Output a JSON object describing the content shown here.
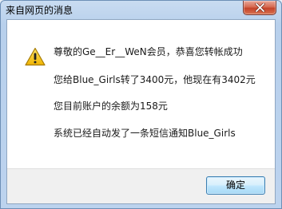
{
  "window": {
    "title": "来自网页的消息"
  },
  "dialog": {
    "icon": "warning-icon",
    "lines": [
      "尊敬的Ge__Er__WeN会员，恭喜您转帐成功",
      "您给Blue_Girls转了3400元，他现在有3402元",
      "您目前账户的余额为158元",
      "系统已经自动发了一条短信通知Blue_Girls"
    ]
  },
  "buttons": {
    "ok_label": "确定"
  },
  "colors": {
    "close_button": "#c4432a",
    "warning_fill": "#f2c21b",
    "frame": "#bcd3ee"
  }
}
